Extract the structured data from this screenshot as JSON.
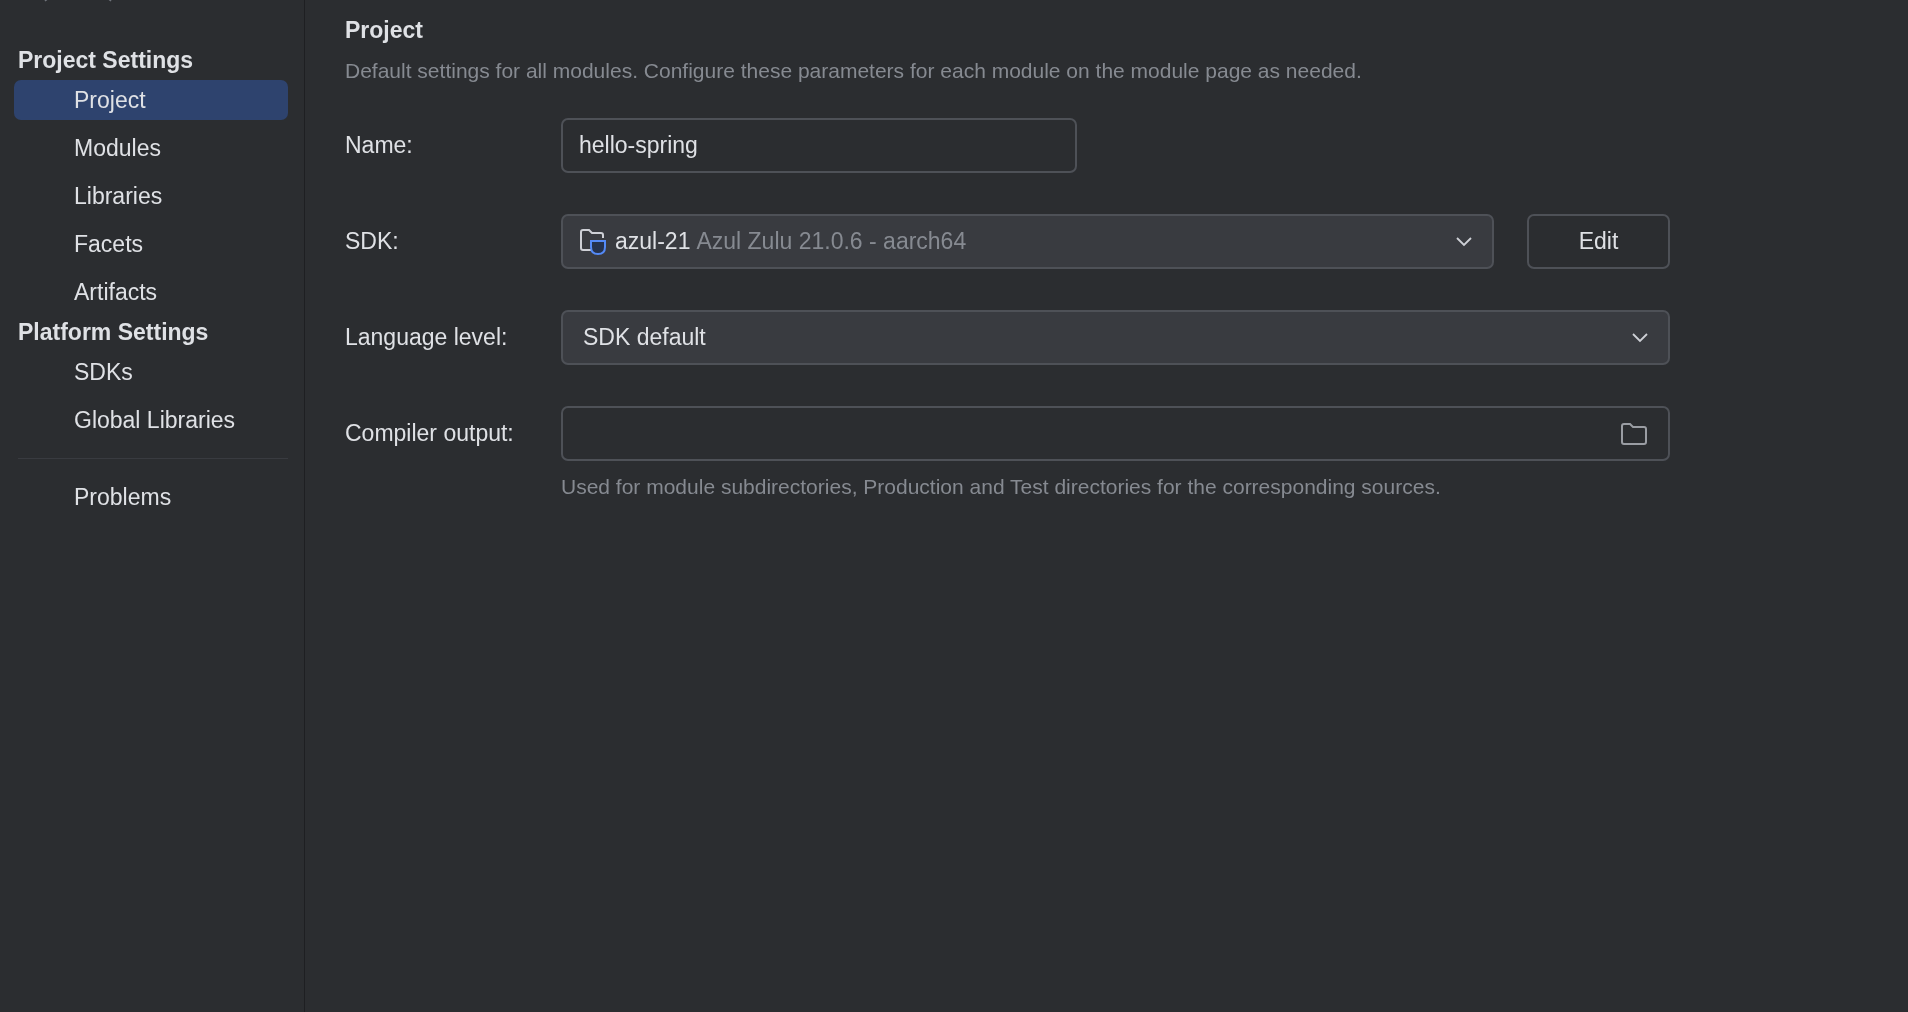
{
  "sidebar": {
    "groups": [
      {
        "title": "Project Settings",
        "items": [
          {
            "label": "Project",
            "selected": true
          },
          {
            "label": "Modules",
            "selected": false
          },
          {
            "label": "Libraries",
            "selected": false
          },
          {
            "label": "Facets",
            "selected": false
          },
          {
            "label": "Artifacts",
            "selected": false
          }
        ]
      },
      {
        "title": "Platform Settings",
        "items": [
          {
            "label": "SDKs",
            "selected": false
          },
          {
            "label": "Global Libraries",
            "selected": false
          }
        ]
      }
    ],
    "extra_items": [
      {
        "label": "Problems",
        "selected": false
      }
    ]
  },
  "main": {
    "title": "Project",
    "description": "Default settings for all modules. Configure these parameters for each module on the module page as needed.",
    "fields": [
      {
        "kind": "text",
        "label": "Name:",
        "value": "hello-spring"
      },
      {
        "kind": "sdk",
        "label": "SDK:",
        "name": "azul-21",
        "detail": "Azul Zulu 21.0.6 - aarch64",
        "button": "Edit"
      },
      {
        "kind": "select",
        "label": "Language level:",
        "value": "SDK default"
      },
      {
        "kind": "path",
        "label": "Compiler output:",
        "hint": "Used for module subdirectories, Production and Test directories for the corresponding sources."
      }
    ]
  }
}
